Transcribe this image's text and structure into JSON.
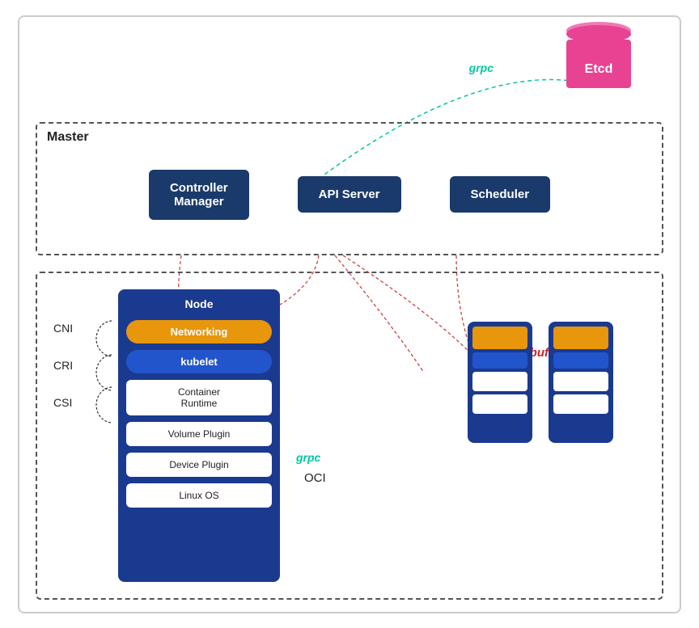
{
  "etcd": {
    "label": "Etcd"
  },
  "grpc_top": {
    "label": "grpc"
  },
  "master": {
    "title": "Master",
    "components": [
      {
        "label": "Controller\nManager",
        "id": "controller-manager"
      },
      {
        "label": "API Server",
        "id": "api-server"
      },
      {
        "label": "Scheduler",
        "id": "scheduler"
      }
    ]
  },
  "node": {
    "title": "Node",
    "networking": "Networking",
    "kubelet": "kubelet",
    "components": [
      {
        "label": "Container\nRuntime"
      },
      {
        "label": "Volume Plugin"
      },
      {
        "label": "Device Plugin"
      },
      {
        "label": "Linux OS"
      }
    ]
  },
  "interfaces": [
    "CNI",
    "CRI",
    "CSI"
  ],
  "grpc_node": {
    "label": "grpc"
  },
  "oci": {
    "label": "OCI"
  },
  "protobuf": {
    "label": "protobuf"
  }
}
